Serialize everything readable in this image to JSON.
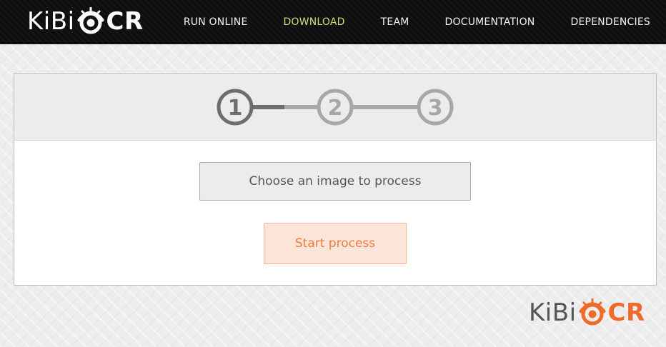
{
  "brand": {
    "prefix": "KiBi",
    "suffix": "CR",
    "accent_color": "#f06a2a"
  },
  "nav": {
    "items": [
      {
        "label": "RUN ONLINE",
        "active": false
      },
      {
        "label": "DOWNLOAD",
        "active": true
      },
      {
        "label": "TEAM",
        "active": false
      },
      {
        "label": "DOCUMENTATION",
        "active": false
      },
      {
        "label": "DEPENDENCIES",
        "active": false
      }
    ],
    "active_color": "#c5e07a"
  },
  "wizard": {
    "steps": [
      "1",
      "2",
      "3"
    ],
    "current_step": 1,
    "choose_label": "Choose an image to process",
    "start_label": "Start process"
  },
  "icons": {
    "logo_eye": "eye-icon"
  }
}
